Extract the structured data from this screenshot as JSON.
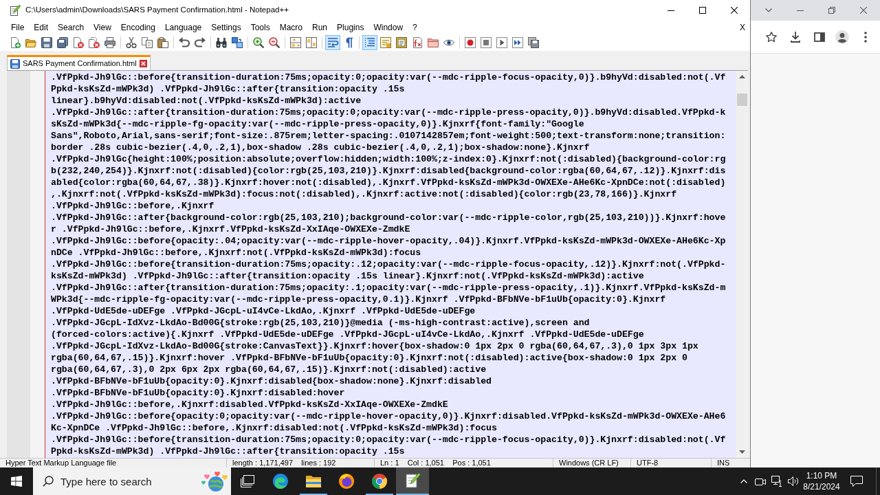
{
  "window": {
    "title": "C:\\Users\\admin\\Downloads\\SARS Payment Confirmation.html - Notepad++"
  },
  "menu": [
    "File",
    "Edit",
    "Search",
    "View",
    "Encoding",
    "Language",
    "Settings",
    "Tools",
    "Macro",
    "Run",
    "Plugins",
    "Window",
    "?"
  ],
  "menu_close": "X",
  "toolbar": [
    [
      {
        "pressed": false
      },
      {
        "pressed": false
      },
      {
        "pressed": false
      },
      {
        "pressed": false
      },
      {
        "pressed": false
      },
      {
        "pressed": false
      },
      {
        "pressed": false
      }
    ],
    [
      {
        "pressed": false
      },
      {
        "pressed": false
      },
      {
        "pressed": false
      }
    ],
    [
      {
        "pressed": false
      },
      {
        "pressed": false
      }
    ],
    [
      {
        "pressed": false
      },
      {
        "pressed": false
      }
    ],
    [
      {
        "pressed": false
      },
      {
        "pressed": false
      }
    ],
    [
      {
        "pressed": false
      },
      {
        "pressed": false
      }
    ],
    [
      {
        "pressed": true
      },
      {
        "pressed": false
      }
    ],
    [
      {
        "pressed": true
      },
      {
        "pressed": false
      },
      {
        "pressed": false
      },
      {
        "pressed": false
      },
      {
        "pressed": false
      },
      {
        "pressed": false
      }
    ],
    [
      {
        "pressed": false
      },
      {
        "pressed": false
      },
      {
        "pressed": false
      },
      {
        "pressed": false
      },
      {
        "pressed": false
      }
    ]
  ],
  "tabs": [
    {
      "label": "SARS Payment Confirmation.html",
      "selected": true
    }
  ],
  "editor": {
    "lines": [
      ".VfPpkd-Jh9lGc::before{transition-duration:75ms;opacity:0;opacity:var(--mdc-ripple-focus-opacity,0)}.b9hyVd:disabled:not(.Vf",
      "Ppkd-ksKsZd-mWPk3d) .VfPpkd-Jh9lGc::after{transition:opacity .15s",
      "linear}.b9hyVd:disabled:not(.VfPpkd-ksKsZd-mWPk3d):active",
      ".VfPpkd-Jh9lGc::after{transition-duration:75ms;opacity:0;opacity:var(--mdc-ripple-press-opacity,0)}.b9hyVd:disabled.VfPpkd-k",
      "sKsZd-mWPk3d{--mdc-ripple-fg-opacity:var(--mdc-ripple-press-opacity,0)}.Kjnxrf{font-family:\"Google",
      "Sans\",Roboto,Arial,sans-serif;font-size:.875rem;letter-spacing:.0107142857em;font-weight:500;text-transform:none;transition:",
      "border .28s cubic-bezier(.4,0,.2,1),box-shadow .28s cubic-bezier(.4,0,.2,1);box-shadow:none}.Kjnxrf",
      ".VfPpkd-Jh9lGc{height:100%;position:absolute;overflow:hidden;width:100%;z-index:0}.Kjnxrf:not(:disabled){background-color:rg",
      "b(232,240,254)}.Kjnxrf:not(:disabled){color:rgb(25,103,210)}.Kjnxrf:disabled{background-color:rgba(60,64,67,.12)}.Kjnxrf:dis",
      "abled{color:rgba(60,64,67,.38)}.Kjnxrf:hover:not(:disabled),.Kjnxrf.VfPpkd-ksKsZd-mWPk3d-OWXEXe-AHe6Kc-XpnDCe:not(:disabled)",
      ",.Kjnxrf:not(.VfPpkd-ksKsZd-mWPk3d):focus:not(:disabled),.Kjnxrf:active:not(:disabled){color:rgb(23,78,166)}.Kjnxrf",
      ".VfPpkd-Jh9lGc::before,.Kjnxrf",
      ".VfPpkd-Jh9lGc::after{background-color:rgb(25,103,210);background-color:var(--mdc-ripple-color,rgb(25,103,210))}.Kjnxrf:hove",
      "r .VfPpkd-Jh9lGc::before,.Kjnxrf.VfPpkd-ksKsZd-XxIAqe-OWXEXe-ZmdkE",
      ".VfPpkd-Jh9lGc::before{opacity:.04;opacity:var(--mdc-ripple-hover-opacity,.04)}.Kjnxrf.VfPpkd-ksKsZd-mWPk3d-OWXEXe-AHe6Kc-Xp",
      "nDCe .VfPpkd-Jh9lGc::before,.Kjnxrf:not(.VfPpkd-ksKsZd-mWPk3d):focus",
      ".VfPpkd-Jh9lGc::before{transition-duration:75ms;opacity:.12;opacity:var(--mdc-ripple-focus-opacity,.12)}.Kjnxrf:not(.VfPpkd-",
      "ksKsZd-mWPk3d) .VfPpkd-Jh9lGc::after{transition:opacity .15s linear}.Kjnxrf:not(.VfPpkd-ksKsZd-mWPk3d):active",
      ".VfPpkd-Jh9lGc::after{transition-duration:75ms;opacity:.1;opacity:var(--mdc-ripple-press-opacity,.1)}.Kjnxrf.VfPpkd-ksKsZd-m",
      "WPk3d{--mdc-ripple-fg-opacity:var(--mdc-ripple-press-opacity,0.1)}.Kjnxrf .VfPpkd-BFbNVe-bF1uUb{opacity:0}.Kjnxrf",
      ".VfPpkd-UdE5de-uDEFge .VfPpkd-JGcpL-uI4vCe-LkdAo,.Kjnxrf .VfPpkd-UdE5de-uDEFge",
      ".VfPpkd-JGcpL-IdXvz-LkdAo-Bd00G{stroke:rgb(25,103,210)}@media (-ms-high-contrast:active),screen and",
      "(forced-colors:active){.Kjnxrf .VfPpkd-UdE5de-uDEFge .VfPpkd-JGcpL-uI4vCe-LkdAo,.Kjnxrf .VfPpkd-UdE5de-uDEFge",
      ".VfPpkd-JGcpL-IdXvz-LkdAo-Bd00G{stroke:CanvasText}}.Kjnxrf:hover{box-shadow:0 1px 2px 0 rgba(60,64,67,.3),0 1px 3px 1px",
      "rgba(60,64,67,.15)}.Kjnxrf:hover .VfPpkd-BFbNVe-bF1uUb{opacity:0}.Kjnxrf:not(:disabled):active{box-shadow:0 1px 2px 0",
      "rgba(60,64,67,.3),0 2px 6px 2px rgba(60,64,67,.15)}.Kjnxrf:not(:disabled):active",
      ".VfPpkd-BFbNVe-bF1uUb{opacity:0}.Kjnxrf:disabled{box-shadow:none}.Kjnxrf:disabled",
      ".VfPpkd-BFbNVe-bF1uUb{opacity:0}.Kjnxrf:disabled:hover",
      ".VfPpkd-Jh9lGc::before,.Kjnxrf:disabled.VfPpkd-ksKsZd-XxIAqe-OWXEXe-ZmdkE",
      ".VfPpkd-Jh9lGc::before{opacity:0;opacity:var(--mdc-ripple-hover-opacity,0)}.Kjnxrf:disabled.VfPpkd-ksKsZd-mWPk3d-OWXEXe-AHe6",
      "Kc-XpnDCe .VfPpkd-Jh9lGc::before,.Kjnxrf:disabled:not(.VfPpkd-ksKsZd-mWPk3d):focus",
      ".VfPpkd-Jh9lGc::before{transition-duration:75ms;opacity:0;opacity:var(--mdc-ripple-focus-opacity,0)}.Kjnxrf:disabled:not(.Vf",
      "Ppkd-ksKsZd-mWPk3d) .VfPpkd-Jh9lGc::after{transition:opacity .15s"
    ]
  },
  "status_bar": [
    "Hyper Text Markup Language file",
    "length : 1,171,497    lines : 192",
    "Ln : 1    Col : 1,051    Pos : 1,051",
    "Windows (CR LF)",
    "UTF-8",
    "INS"
  ],
  "taskbar": {
    "search": {
      "placeholder": "Type here to search"
    },
    "apps": [
      {
        "running": false,
        "selected": false
      },
      {
        "running": true,
        "selected": false
      },
      {
        "running": false,
        "selected": false
      },
      {
        "running": true,
        "selected": false
      },
      {
        "running": true,
        "selected": true
      }
    ],
    "clock": {
      "time": "1:10 PM",
      "date": "8/21/2024"
    }
  }
}
